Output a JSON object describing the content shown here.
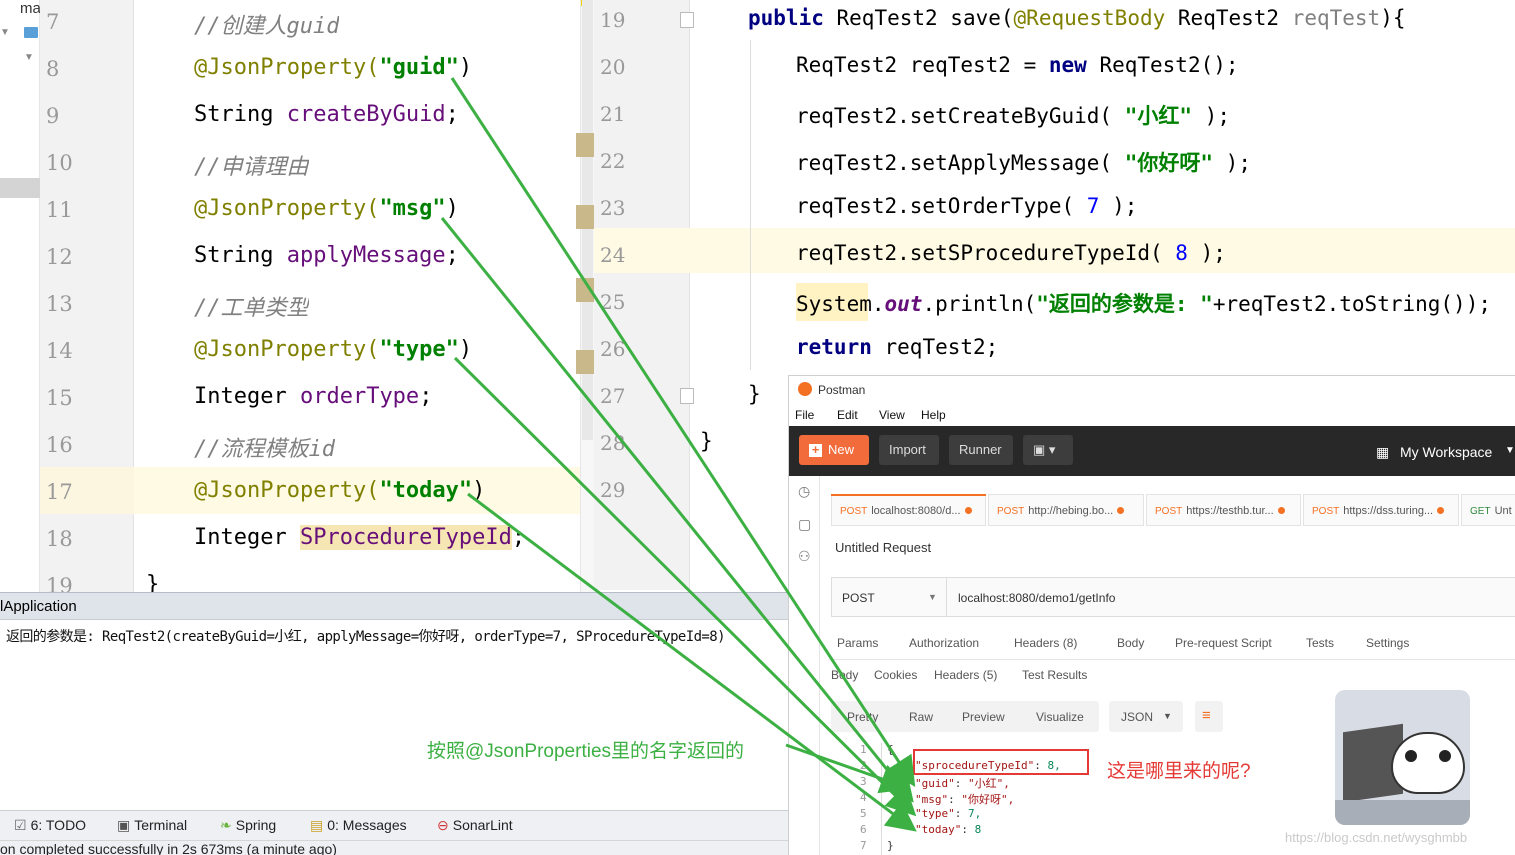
{
  "tree": {
    "label": "ma"
  },
  "left_editor": {
    "lines": [
      {
        "n": "7",
        "parts": [
          {
            "t": "//创建人guid",
            "c": "cmt"
          }
        ]
      },
      {
        "n": "8",
        "parts": [
          {
            "t": "@JsonProperty(",
            "c": "ann"
          },
          {
            "t": "\"guid\"",
            "c": "str"
          },
          {
            "t": ")",
            "c": ""
          }
        ]
      },
      {
        "n": "9",
        "parts": [
          {
            "t": "String ",
            "c": ""
          },
          {
            "t": "createByGuid",
            "c": "fld"
          },
          {
            "t": ";",
            "c": ""
          }
        ]
      },
      {
        "n": "10",
        "parts": [
          {
            "t": "//申请理由",
            "c": "cmt"
          }
        ]
      },
      {
        "n": "11",
        "parts": [
          {
            "t": "@JsonProperty(",
            "c": "ann"
          },
          {
            "t": "\"msg\"",
            "c": "str"
          },
          {
            "t": ")",
            "c": ""
          }
        ]
      },
      {
        "n": "12",
        "parts": [
          {
            "t": "String ",
            "c": ""
          },
          {
            "t": "applyMessage",
            "c": "fld"
          },
          {
            "t": ";",
            "c": ""
          }
        ]
      },
      {
        "n": "13",
        "parts": [
          {
            "t": "//工单类型",
            "c": "cmt"
          }
        ]
      },
      {
        "n": "14",
        "parts": [
          {
            "t": "@JsonProperty(",
            "c": "ann"
          },
          {
            "t": "\"type\"",
            "c": "str"
          },
          {
            "t": ")",
            "c": ""
          }
        ]
      },
      {
        "n": "15",
        "parts": [
          {
            "t": "Integer ",
            "c": ""
          },
          {
            "t": "orderType",
            "c": "fld"
          },
          {
            "t": ";",
            "c": ""
          }
        ]
      },
      {
        "n": "16",
        "parts": [
          {
            "t": "//流程模板id",
            "c": "cmt"
          }
        ]
      },
      {
        "n": "17",
        "parts": [
          {
            "t": "@JsonProperty(",
            "c": "ann"
          },
          {
            "t": "\"today\"",
            "c": "str"
          },
          {
            "t": ")",
            "c": ""
          }
        ]
      },
      {
        "n": "18",
        "parts": [
          {
            "t": "Integer ",
            "c": ""
          },
          {
            "t": "SProcedureTypeId",
            "c": "fld"
          },
          {
            "t": ";",
            "c": ""
          }
        ]
      },
      {
        "n": "19",
        "parts": [
          {
            "t": "}",
            "c": ""
          }
        ]
      }
    ]
  },
  "right_editor": {
    "lines": [
      {
        "n": "19",
        "parts": [
          {
            "t": "public ",
            "c": "kw"
          },
          {
            "t": "ReqTest2 save(",
            "c": ""
          },
          {
            "t": "@RequestBody ",
            "c": "ann"
          },
          {
            "t": "ReqTest2 ",
            "c": ""
          },
          {
            "t": "reqTest",
            "c": "cmtplain"
          },
          {
            "t": "){",
            "c": ""
          }
        ]
      },
      {
        "n": "20",
        "parts": [
          {
            "t": "ReqTest2 reqTest2 = ",
            "c": ""
          },
          {
            "t": "new ",
            "c": "kw"
          },
          {
            "t": "ReqTest2();",
            "c": ""
          }
        ]
      },
      {
        "n": "21",
        "parts": [
          {
            "t": "reqTest2.setCreateByGuid( ",
            "c": ""
          },
          {
            "t": "\"小红\"",
            "c": "str"
          },
          {
            "t": " );",
            "c": ""
          }
        ]
      },
      {
        "n": "22",
        "parts": [
          {
            "t": "reqTest2.setApplyMessage( ",
            "c": ""
          },
          {
            "t": "\"你好呀\"",
            "c": "str"
          },
          {
            "t": " );",
            "c": ""
          }
        ]
      },
      {
        "n": "23",
        "parts": [
          {
            "t": "reqTest2.setOrderType( ",
            "c": ""
          },
          {
            "t": "7",
            "c": "num"
          },
          {
            "t": " );",
            "c": ""
          }
        ]
      },
      {
        "n": "24",
        "parts": [
          {
            "t": "reqTest2.setSProcedureTypeId( ",
            "c": ""
          },
          {
            "t": "8",
            "c": "num"
          },
          {
            "t": " );",
            "c": ""
          }
        ]
      },
      {
        "n": "25",
        "parts": [
          {
            "t": "System.",
            "c": ""
          },
          {
            "t": "out",
            "c": "fldi"
          },
          {
            "t": ".println(",
            "c": ""
          },
          {
            "t": "\"返回的参数是: \"",
            "c": "str"
          },
          {
            "t": "+reqTest2.toString());",
            "c": ""
          }
        ]
      },
      {
        "n": "26",
        "parts": [
          {
            "t": "return ",
            "c": "kw"
          },
          {
            "t": "reqTest2;",
            "c": ""
          }
        ]
      },
      {
        "n": "27",
        "parts": [
          {
            "t": "}",
            "c": ""
          }
        ]
      },
      {
        "n": "28",
        "parts": [
          {
            "t": "}",
            "c": ""
          }
        ]
      },
      {
        "n": "29",
        "parts": []
      }
    ]
  },
  "run_panel": {
    "title": "lApplication",
    "output": "返回的参数是: ReqTest2(createByGuid=小红, applyMessage=你好呀, orderType=7, SProcedureTypeId=8)",
    "annotation": "按照@JsonProperties里的名字返回的"
  },
  "bottom_bar": {
    "items": [
      {
        "label": "6: TODO",
        "icon": "todo-icon"
      },
      {
        "label": "Terminal",
        "icon": "terminal-icon"
      },
      {
        "label": "Spring",
        "icon": "spring-icon"
      },
      {
        "label": "0: Messages",
        "icon": "messages-icon"
      },
      {
        "label": "SonarLint",
        "icon": "sonarlint-icon"
      }
    ],
    "status": "on completed successfully in 2s 673ms (a minute ago)"
  },
  "postman": {
    "title": "Postman",
    "menu": [
      "File",
      "Edit",
      "View",
      "Help"
    ],
    "toolbar": {
      "new": "New",
      "import": "Import",
      "runner": "Runner",
      "workspace": "My Workspace"
    },
    "tabs": [
      {
        "method": "POST",
        "url": "localhost:8080/d..."
      },
      {
        "method": "POST",
        "url": "http://hebing.bo..."
      },
      {
        "method": "POST",
        "url": "https://testhb.tur..."
      },
      {
        "method": "POST",
        "url": "https://dss.turing..."
      },
      {
        "method": "GET",
        "url": "Unt"
      }
    ],
    "request_name": "Untitled Request",
    "method": "POST",
    "url": "localhost:8080/demo1/getInfo",
    "req_tabs": [
      "Params",
      "Authorization",
      "Headers (8)",
      "Body",
      "Pre-request Script",
      "Tests",
      "Settings"
    ],
    "resp_tabs": [
      "Body",
      "Cookies",
      "Headers (5)",
      "Test Results"
    ],
    "view_tabs": [
      "Pretty",
      "Raw",
      "Preview",
      "Visualize"
    ],
    "format": "JSON",
    "json_lines": [
      {
        "n": "1",
        "text": "{"
      },
      {
        "n": "2",
        "key": "\"sprocedureTypeId\"",
        "val": "8,"
      },
      {
        "n": "3",
        "key": "\"guid\"",
        "val": "\"小红\","
      },
      {
        "n": "4",
        "key": "\"msg\"",
        "val": "\"你好呀\","
      },
      {
        "n": "5",
        "key": "\"type\"",
        "val": "7,"
      },
      {
        "n": "6",
        "key": "\"today\"",
        "val": "8"
      },
      {
        "n": "7",
        "text": "}"
      }
    ],
    "question": "这是哪里来的呢?",
    "watermark": "https://blog.csdn.net/wysghmbb"
  }
}
